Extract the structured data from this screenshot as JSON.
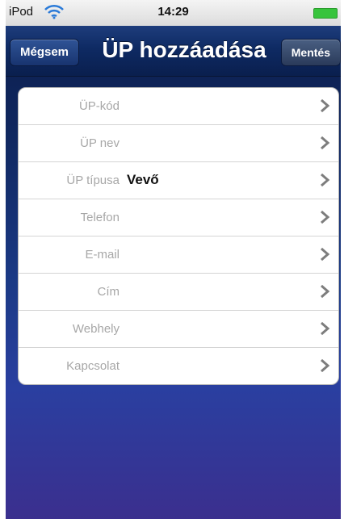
{
  "statusbar": {
    "device": "iPod",
    "time": "14:29",
    "wifi_icon": "wifi-icon",
    "battery_icon": "battery-icon",
    "battery_color": "#37c43c"
  },
  "navbar": {
    "cancel_label": "Mégsem",
    "title": "ÜP hozzáadása",
    "save_label": "Mentés"
  },
  "form": {
    "rows": [
      {
        "label": "ÜP-kód",
        "value": ""
      },
      {
        "label": "ÜP nev",
        "value": ""
      },
      {
        "label": "ÜP típusa",
        "value": "Vevő"
      },
      {
        "label": "Telefon",
        "value": ""
      },
      {
        "label": "E-mail",
        "value": ""
      },
      {
        "label": "Cím",
        "value": ""
      },
      {
        "label": "Webhely",
        "value": ""
      },
      {
        "label": "Kapcsolat",
        "value": ""
      }
    ],
    "chevron_icon": "chevron-right-icon"
  },
  "colors": {
    "label": "#a7a7a7",
    "value": "#111111",
    "navbar": "#0e2a63"
  }
}
